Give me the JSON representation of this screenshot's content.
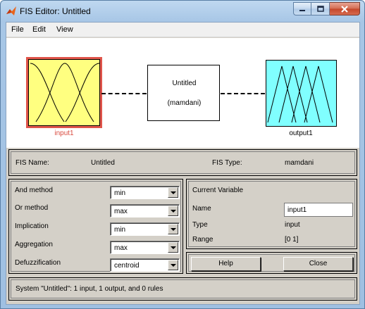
{
  "window": {
    "title": "FIS Editor: Untitled",
    "icons": {
      "app": "matlab-logo-icon",
      "minimize": "minimize-icon",
      "maximize": "maximize-icon",
      "close": "close-icon"
    }
  },
  "menu": {
    "items": [
      "File",
      "Edit",
      "View"
    ]
  },
  "diagram": {
    "input_label": "input1",
    "output_label": "output1",
    "system_name": "Untitled",
    "system_type": "(mamdani)",
    "colors": {
      "input_fill": "#ffff80",
      "input_highlight": "#e0554a",
      "output_fill": "#80ffff",
      "input_label": "#d94b3f"
    }
  },
  "info": {
    "fis_name_label": "FIS Name:",
    "fis_name_value": "Untitled",
    "fis_type_label": "FIS Type:",
    "fis_type_value": "mamdani"
  },
  "methods": {
    "and_label": "And method",
    "and_value": "min",
    "or_label": "Or method",
    "or_value": "max",
    "implication_label": "Implication",
    "implication_value": "min",
    "aggregation_label": "Aggregation",
    "aggregation_value": "max",
    "defuzz_label": "Defuzzification",
    "defuzz_value": "centroid"
  },
  "current_variable": {
    "heading": "Current Variable",
    "name_label": "Name",
    "name_value": "input1",
    "type_label": "Type",
    "type_value": "input",
    "range_label": "Range",
    "range_value": "[0 1]"
  },
  "buttons": {
    "help": "Help",
    "close": "Close"
  },
  "status": {
    "text": "System \"Untitled\": 1 input, 1 output, and 0 rules"
  }
}
